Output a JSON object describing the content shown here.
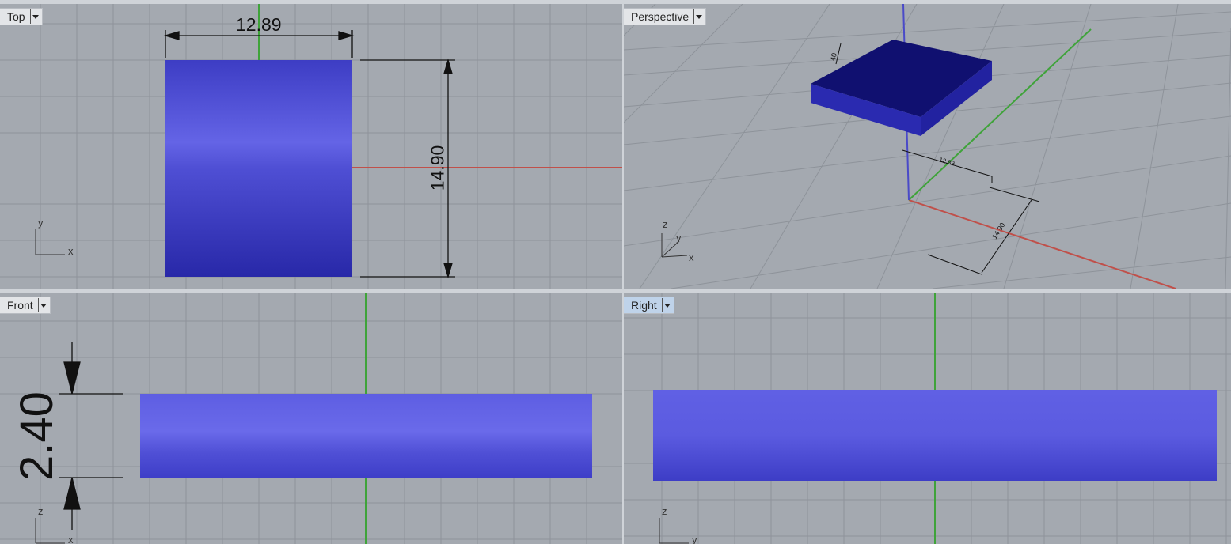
{
  "viewports": {
    "top": {
      "label": "Top",
      "dim_width": "12.89",
      "dim_height": "14.90",
      "axis_x": "x",
      "axis_y": "y"
    },
    "perspective": {
      "label": "Perspective",
      "dim_thickness": "40",
      "dim_width": "12.89",
      "dim_depth": "14.90",
      "axis_x": "x",
      "axis_y": "y",
      "axis_z": "z"
    },
    "front": {
      "label": "Front",
      "dim_thickness": "2.40",
      "axis_x": "x",
      "axis_z": "z"
    },
    "right": {
      "label": "Right",
      "axis_y": "y",
      "axis_z": "z"
    }
  },
  "colors": {
    "background": "#a4a9b0",
    "grid": "#8e939a",
    "x_axis": "#c0504a",
    "y_axis": "#3fa33a",
    "z_axis": "#4a4ac8",
    "object": "#3c3cc8",
    "active_tab": "#bfd3ea"
  },
  "icons": [
    "viewport-menu-icon",
    "world-axes-icon"
  ]
}
